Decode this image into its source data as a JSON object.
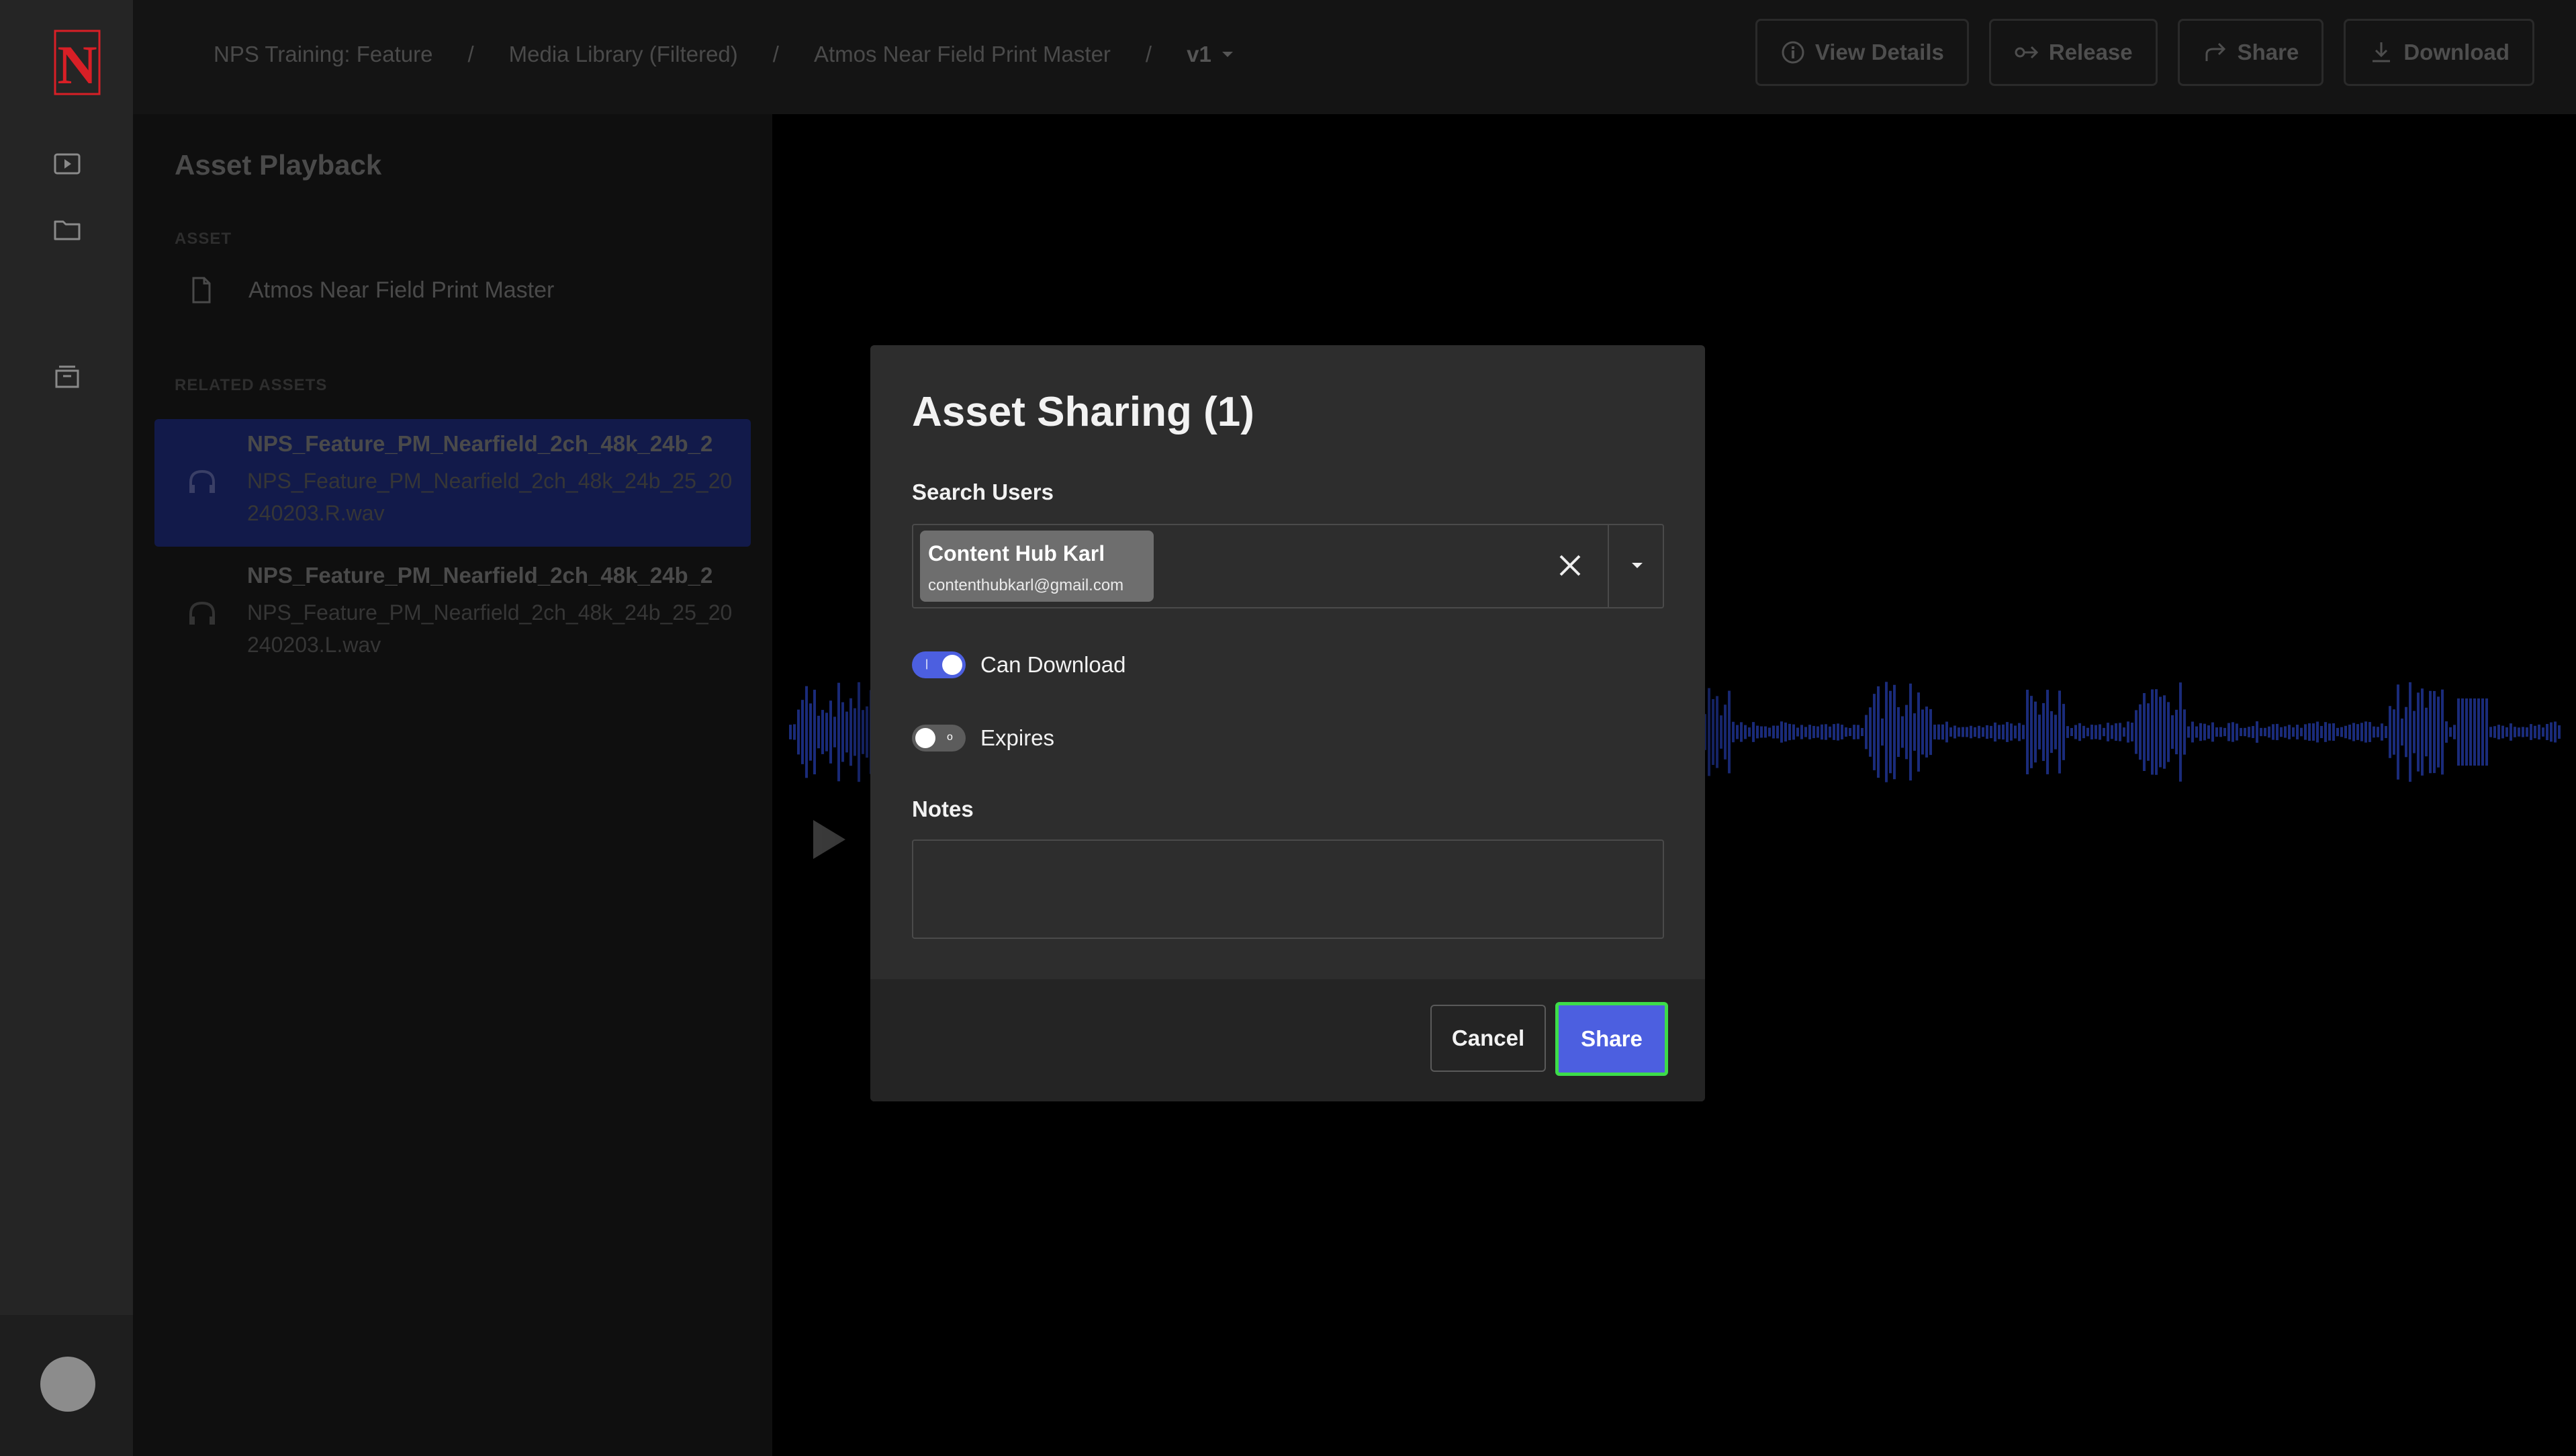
{
  "colors": {
    "accent": "#4c5fe0",
    "focus_ring": "#3ddc4a",
    "logo_red": "#d81f26",
    "waveform": "#1a2b7a"
  },
  "rail": {
    "logo_letter": "N",
    "icons": [
      "play-box-icon",
      "folder-icon",
      "archive-icon"
    ]
  },
  "breadcrumb": {
    "items": [
      "NPS Training: Feature",
      "Media Library (Filtered)",
      "Atmos Near Field Print Master"
    ],
    "separator": "/",
    "version": "v1"
  },
  "toolbar": {
    "view_details": "View Details",
    "release": "Release",
    "share": "Share",
    "download": "Download"
  },
  "panel": {
    "title": "Asset Playback",
    "asset_section": "ASSET",
    "asset_name": "Atmos Near Field Print Master",
    "related_section": "RELATED ASSETS",
    "related": [
      {
        "title": "NPS_Feature_PM_Nearfield_2ch_48k_24b_2",
        "filename": "NPS_Feature_PM_Nearfield_2ch_48k_24b_25_20240203.R.wav"
      },
      {
        "title": "NPS_Feature_PM_Nearfield_2ch_48k_24b_2",
        "filename": "NPS_Feature_PM_Nearfield_2ch_48k_24b_25_20240203.L.wav"
      }
    ]
  },
  "modal": {
    "title": "Asset Sharing (1)",
    "search_label": "Search Users",
    "selected_user": {
      "name": "Content Hub Karl",
      "email": "contenthubkarl@gmail.com"
    },
    "can_download_label": "Can Download",
    "can_download": true,
    "expires_label": "Expires",
    "expires": false,
    "notes_label": "Notes",
    "notes_value": "",
    "cancel_label": "Cancel",
    "share_label": "Share"
  }
}
